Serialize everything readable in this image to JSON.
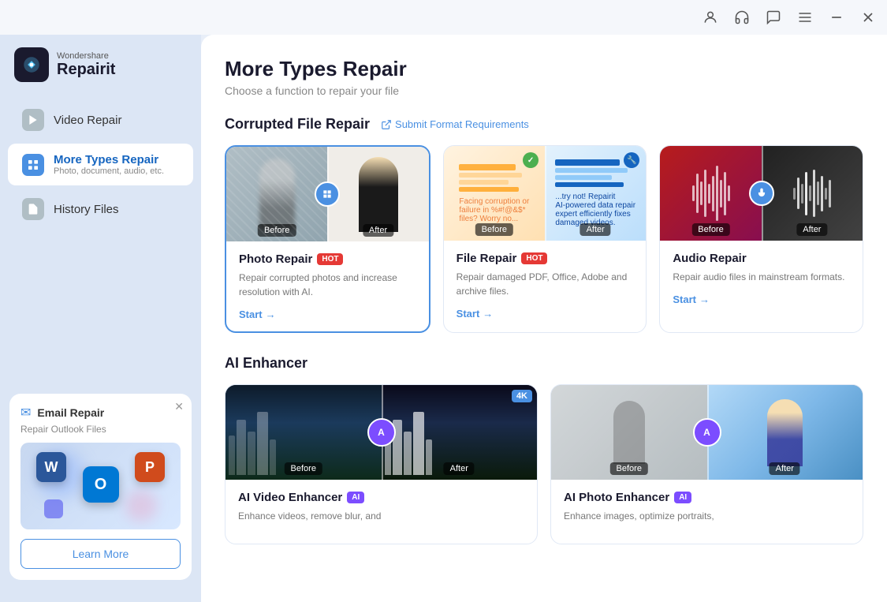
{
  "titlebar": {
    "icons": [
      "user-icon",
      "headset-icon",
      "chat-icon",
      "menu-icon",
      "minimize-icon",
      "close-icon"
    ]
  },
  "sidebar": {
    "logo": {
      "brand": "Wondershare",
      "product": "Repairit"
    },
    "nav_items": [
      {
        "id": "video-repair",
        "label": "Video Repair",
        "sublabel": "",
        "active": false
      },
      {
        "id": "more-types-repair",
        "label": "More Types Repair",
        "sublabel": "Photo, document, audio, etc.",
        "active": true
      },
      {
        "id": "history-files",
        "label": "History Files",
        "sublabel": "",
        "active": false
      }
    ],
    "email_card": {
      "title": "Email Repair",
      "subtitle": "Repair Outlook Files",
      "learn_more": "Learn More"
    }
  },
  "main": {
    "title": "More Types Repair",
    "subtitle": "Choose a function to repair your file",
    "sections": {
      "corrupted_file_repair": {
        "title": "Corrupted File Repair",
        "submit_link": "Submit Format Requirements",
        "cards": [
          {
            "id": "photo-repair",
            "name": "Photo Repair",
            "badge": "HOT",
            "badge_type": "hot",
            "desc": "Repair corrupted photos and increase resolution with AI.",
            "start": "Start",
            "before_label": "Before",
            "after_label": "After",
            "selected": true
          },
          {
            "id": "file-repair",
            "name": "File Repair",
            "badge": "HOT",
            "badge_type": "hot",
            "desc": "Repair damaged PDF, Office, Adobe and archive files.",
            "start": "Start",
            "before_label": "Before",
            "after_label": "After",
            "selected": false
          },
          {
            "id": "audio-repair",
            "name": "Audio Repair",
            "badge": "",
            "badge_type": "",
            "desc": "Repair audio files in mainstream formats.",
            "start": "Start",
            "before_label": "Before",
            "after_label": "After",
            "selected": false
          }
        ]
      },
      "ai_enhancer": {
        "title": "AI Enhancer",
        "cards": [
          {
            "id": "ai-video-enhancer",
            "name": "AI Video Enhancer",
            "badge": "AI",
            "badge_type": "ai",
            "desc": "Enhance videos, remove blur, and",
            "before_label": "Before",
            "after_label": "After",
            "has_4k": true
          },
          {
            "id": "ai-photo-enhancer",
            "name": "AI Photo Enhancer",
            "badge": "AI",
            "badge_type": "ai",
            "desc": "Enhance images, optimize portraits,",
            "before_label": "Before",
            "after_label": "After",
            "has_4k": false
          }
        ]
      }
    }
  }
}
